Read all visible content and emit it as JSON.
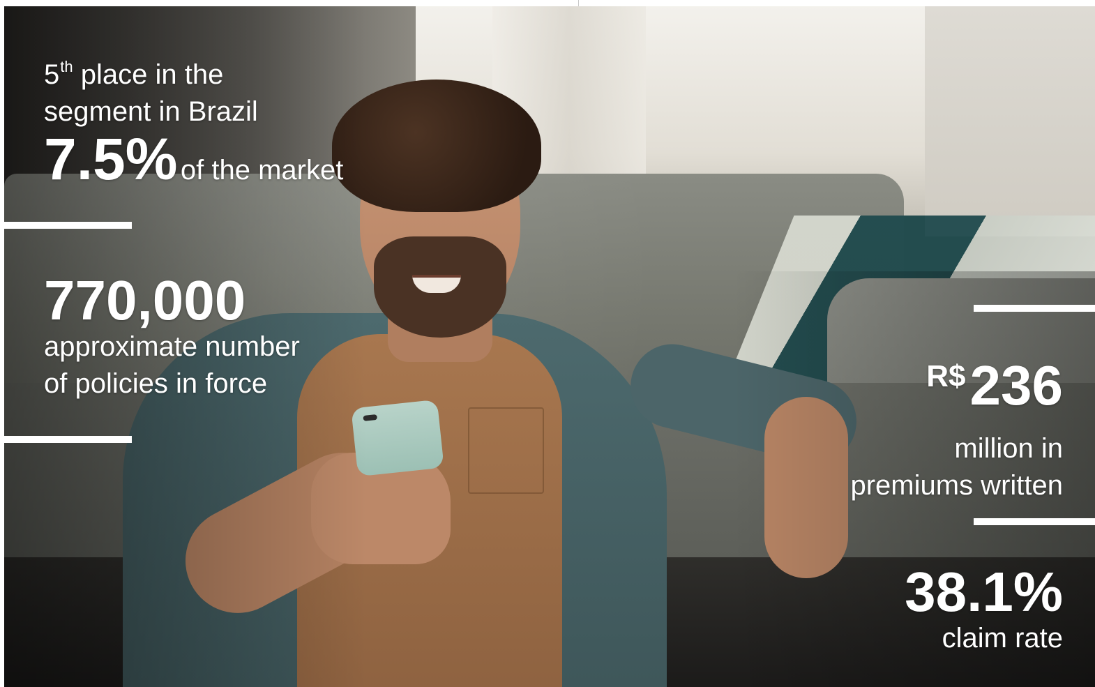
{
  "stats": {
    "ranking": {
      "prefix": "5",
      "superscript": "th",
      "line1_rest": " place in the",
      "line2": "segment in Brazil"
    },
    "market_share": {
      "value": "7.5%",
      "label": "of the market"
    },
    "policies": {
      "value": "770,000",
      "line1": "approximate number",
      "line2": "of policies in force"
    },
    "premiums": {
      "currency": "R$",
      "value": "236",
      "line1": "million in",
      "line2": "premiums written"
    },
    "claims": {
      "value": "38.1%",
      "label": "claim rate"
    }
  },
  "colors": {
    "text": "#ffffff",
    "accent_bar": "#ffffff"
  }
}
